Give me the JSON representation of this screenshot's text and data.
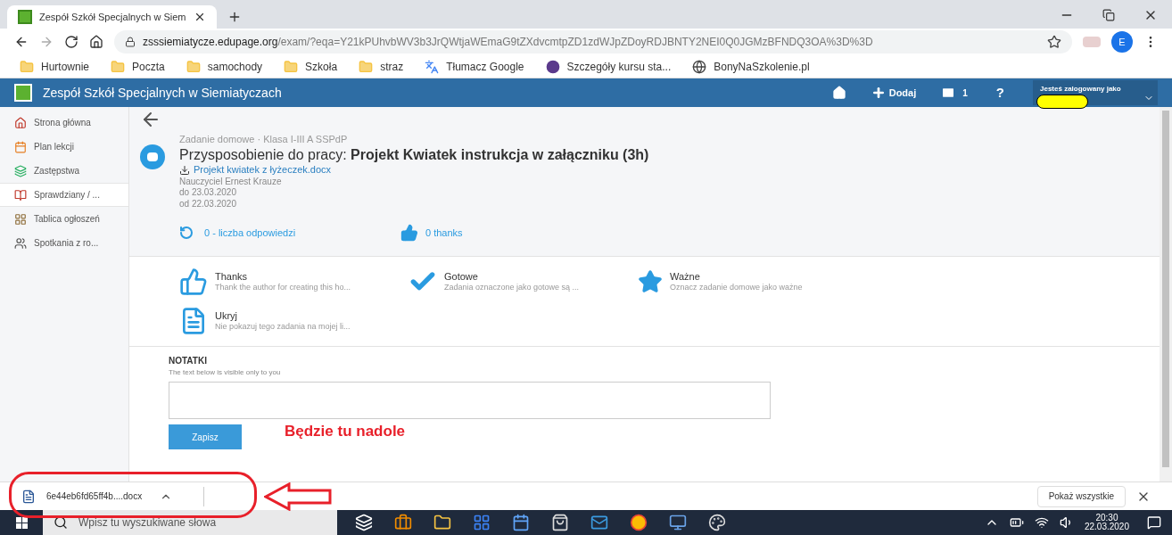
{
  "browser": {
    "tab_title": "Zespół Szkół Specjalnych w Siem",
    "url_host": "zsssiemiatycze.edupage.org",
    "url_path": "/exam/?eqa=Y21kPUhvbWV3b3JrQWtjaWEmaG9tZXdvcmtpZD1zdWJpZDoyRDJBNTY2NEI0Q0JGMzBFNDQ3OA%3D%3D",
    "profile": "E",
    "bookmarks": [
      {
        "label": "Hurtownie",
        "kind": "folder"
      },
      {
        "label": "Poczta",
        "kind": "folder"
      },
      {
        "label": "samochody",
        "kind": "folder"
      },
      {
        "label": "Szkoła",
        "kind": "folder"
      },
      {
        "label": "straz",
        "kind": "folder"
      },
      {
        "label": "Tłumacz Google",
        "kind": "translate"
      },
      {
        "label": "Szczegóły kursu sta...",
        "kind": "course"
      },
      {
        "label": "BonyNaSzkolenie.pl",
        "kind": "globe"
      }
    ]
  },
  "header": {
    "title": "Zespół Szkół Specjalnych w Siemiatyczach",
    "add": "Dodaj",
    "mail_count": "1",
    "help": "?",
    "user_label": "Jesteś zalogowany jako"
  },
  "sidebar": {
    "items": [
      {
        "label": "Strona główna",
        "selected": false
      },
      {
        "label": "Plan lekcji",
        "selected": false
      },
      {
        "label": "Zastępstwa",
        "selected": false
      },
      {
        "label": "Sprawdziany / ...",
        "selected": true
      },
      {
        "label": "Tablica ogłoszeń",
        "selected": false
      },
      {
        "label": "Spotkania z ro...",
        "selected": false
      }
    ]
  },
  "task": {
    "meta": "Zadanie domowe · Klasa I-III A SSPdP",
    "title": "Przysposobienie do pracy: **Projekt Kwiatek instrukcja w załączniku (3h)**",
    "attachment": "Projekt kwiatek z łyżeczek.docx",
    "teacher": "Nauczyciel Ernest Krauze",
    "due": "do 23.03.2020",
    "from": "od 22.03.2020",
    "replies": "0 - liczba odpowiedzi",
    "thanks": "0 thanks"
  },
  "actions": [
    {
      "kind": "thumb",
      "title": "Thanks",
      "desc": "Thank the author for creating this ho..."
    },
    {
      "kind": "check",
      "title": "Gotowe",
      "desc": "Zadania oznaczone jako gotowe są ..."
    },
    {
      "kind": "star",
      "title": "Ważne",
      "desc": "Oznacz zadanie domowe jako ważne"
    },
    {
      "kind": "doc",
      "title": "Ukryj",
      "desc": "Nie pokazuj tego zadania na mojej li..."
    }
  ],
  "notes": {
    "heading": "NOTATKI",
    "hint": "The text below is visible only to you",
    "save": "Zapisz"
  },
  "annotation": "Będzie tu nadole",
  "downloads": {
    "file": "6e44eb6fd65ff4b....docx",
    "show_all": "Pokaż wszystkie"
  },
  "taskbar": {
    "search_placeholder": "Wpisz tu wyszukiwane słowa",
    "time": "20:30",
    "date": "22.03.2020"
  }
}
